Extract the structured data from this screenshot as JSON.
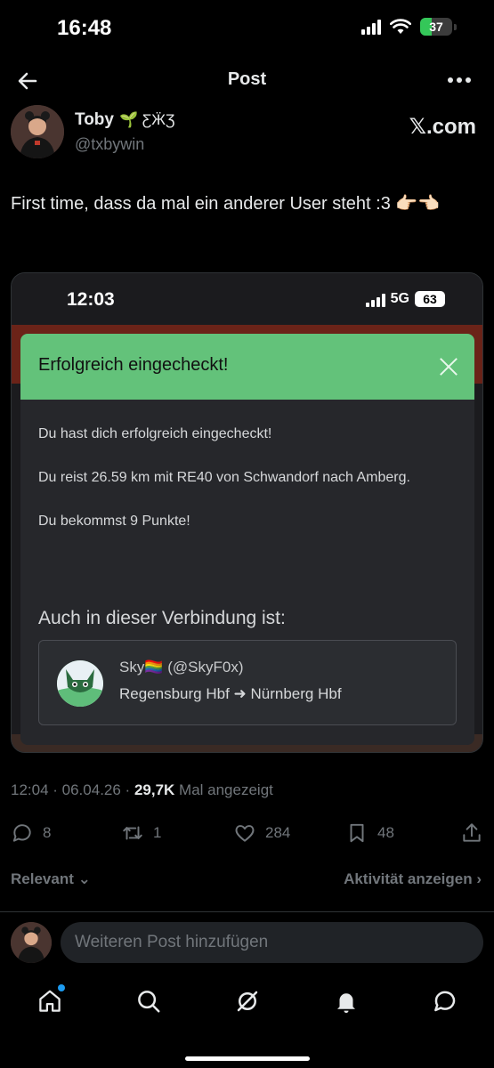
{
  "status_bar": {
    "time": "16:48",
    "battery": "37",
    "battery_level": 0.37
  },
  "header": {
    "title": "Post"
  },
  "author": {
    "name": "Toby",
    "name_emoji": "🌱 ƸӜƷ",
    "handle": "@txbywin",
    "source_label": "𝕏.com"
  },
  "post": {
    "text": "First time, dass da mal ein anderer User steht :3 👉🏻👈🏻"
  },
  "embed": {
    "time": "12:03",
    "network": "5G",
    "battery": "63",
    "modal": {
      "title": "Erfolgreich eingecheckt!",
      "line1": "Du hast dich erfolgreich eingecheckt!",
      "line2": "Du reist 26.59 km mit RE40 von Schwandorf nach Amberg.",
      "line3": "Du bekommst 9 Punkte!",
      "subheading": "Auch in dieser Verbindung ist:",
      "user": {
        "name": "Sky🏳️‍🌈 (@SkyF0x)",
        "route": "Regensburg Hbf ➜ Nürnberg Hbf"
      }
    }
  },
  "meta": {
    "time_date": "12:04 · 06.04.26 · ",
    "views": "29,7K",
    "views_label": " Mal angezeigt"
  },
  "actions": {
    "replies": "8",
    "reposts": "1",
    "likes": "284",
    "bookmarks": "48"
  },
  "sortbar": {
    "left": "Relevant ⌄",
    "right": "Aktivität anzeigen ›"
  },
  "reply": {
    "placeholder": "Weiteren Post hinzufügen"
  },
  "colors": {
    "background": "#000000",
    "text": "#e7e9ea",
    "muted": "#71767b",
    "success_green": "#63c27a",
    "accent": "#1d9bf0"
  }
}
